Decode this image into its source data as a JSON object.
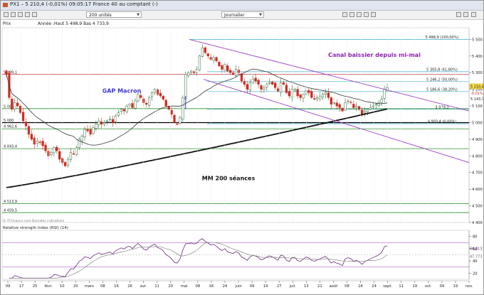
{
  "window": {
    "title": "PX1 – 5 210,4 (-0,01%) 09:05:17 France 40 au comptant (-)"
  },
  "toolbar": {
    "units_select": "200 unités",
    "period_select": "Journalier"
  },
  "header": {
    "tab_label": "Prix",
    "ohlc_info": "Année :Haut 5 498,9 Bas 4 733,9"
  },
  "colors": {
    "price_up": "#2f6a3a",
    "price_down": "#cf2b1f",
    "ma200": "#111111",
    "ma50": "#333333",
    "channel": "#9b3fc6",
    "fib_lines": "#3aaecc",
    "support_green": "#2d8f2d",
    "resistance_red": "#c0303a",
    "annotation_blue": "#3a34d6",
    "annotation_purple": "#8b1fb3",
    "current_price_box": "#ffe34d",
    "rsi_line": "#6a2a7a"
  },
  "chart_data": {
    "type": "candlestick",
    "title": "",
    "x_ticks": [
      "09",
      "17",
      "25",
      "févr.",
      "10",
      "20",
      "mars",
      "08",
      "16",
      "26",
      "avr.",
      "11",
      "20",
      "mai",
      "08",
      "16",
      "24",
      "juin",
      "09",
      "19",
      "27",
      "juil.",
      "13",
      "21",
      "août",
      "08",
      "16",
      "24",
      "sept.",
      "11",
      "19",
      "oct.",
      "09",
      "19",
      "nov."
    ],
    "y_ticks": [
      "5 500",
      "5 400",
      "5 300",
      "5 200",
      "5 100",
      "5 000",
      "4 900",
      "4 800",
      "4 700",
      "4 600",
      "4 500",
      "4 400"
    ],
    "ylim": [
      4400,
      5570
    ],
    "level_labels": [
      {
        "text": "5 498,9 (100,00%)",
        "value": 5498.9
      },
      {
        "text": "5 305,8 (61,80%)",
        "value": 5305.8
      },
      {
        "text": "5 246,2 (50,00%)",
        "value": 5246.2
      },
      {
        "text": "5 186,6 (38,20%)",
        "value": 5186.6
      },
      {
        "text": "5 079,3",
        "value": 5079.3
      },
      {
        "text": "4 993,4 (0,00%)",
        "value": 4993.4
      }
    ],
    "horizontal_levels": [
      {
        "text": "5 289,1",
        "value": 5289.1,
        "color": "red"
      },
      {
        "text": "5 084",
        "value": 5084,
        "color": "green"
      },
      {
        "text": "5 000",
        "value": 5000,
        "color": "black"
      },
      {
        "text": "4 962,6",
        "value": 4962.6,
        "color": "green"
      },
      {
        "text": "4 843,4",
        "value": 4843.4,
        "color": "green"
      },
      {
        "text": "4 513,9",
        "value": 4513.9,
        "color": "green"
      },
      {
        "text": "4 459,5",
        "value": 4459.5,
        "color": "green"
      }
    ],
    "current_price": {
      "value": "5 210,4",
      "change": "-0,01%",
      "prev": "5 143,7",
      "support": "5 100"
    },
    "annotations": [
      {
        "text": "Canal baissier depuis mi-mai"
      },
      {
        "text": "GAP Macron"
      },
      {
        "text": "MM 200 séances"
      }
    ],
    "closes": [
      5290,
      5150,
      5080,
      5120,
      5100,
      5060,
      5010,
      4980,
      4930,
      4900,
      4870,
      4890,
      4880,
      4860,
      4830,
      4800,
      4820,
      4850,
      4830,
      4780,
      4760,
      4740,
      4780,
      4820,
      4810,
      4850,
      4900,
      4920,
      4960,
      4950,
      4930,
      4970,
      4990,
      5010,
      4990,
      5000,
      5010,
      5020,
      5000,
      5040,
      5060,
      5080,
      5070,
      5100,
      5110,
      5090,
      5130,
      5170,
      5150,
      5120,
      5110,
      5150,
      5180,
      5200,
      5170,
      5160,
      5140,
      5100,
      5080,
      5050,
      5000,
      4990,
      5030,
      5150,
      5290,
      5300,
      5310,
      5300,
      5320,
      5400,
      5450,
      5420,
      5400,
      5380,
      5390,
      5370,
      5340,
      5320,
      5350,
      5310,
      5300,
      5290,
      5320,
      5300,
      5250,
      5230,
      5200,
      5240,
      5260,
      5250,
      5230,
      5200,
      5210,
      5230,
      5240,
      5230,
      5210,
      5190,
      5240,
      5230,
      5180,
      5160,
      5200,
      5200,
      5160,
      5150,
      5170,
      5190,
      5180,
      5150,
      5140,
      5150,
      5160,
      5170,
      5180,
      5150,
      5110,
      5120,
      5100,
      5090,
      5070,
      5120,
      5130,
      5120,
      5090,
      5100,
      5080,
      5050,
      5070,
      5080,
      5090,
      5100,
      5110,
      5120,
      5140,
      5200,
      5210
    ],
    "ma200": {
      "start": 4610,
      "end": 5082,
      "description": "200-session moving average rising from lower-left to the current price area"
    },
    "rsi": {
      "title": "Relative strength index (RSI) (14)",
      "y_ticks": [
        "80",
        "60",
        "40",
        "20"
      ],
      "last_value": "60,413",
      "signal_value": "47,773"
    },
    "source_note": "© IT-Finance.com Données indicatives"
  }
}
